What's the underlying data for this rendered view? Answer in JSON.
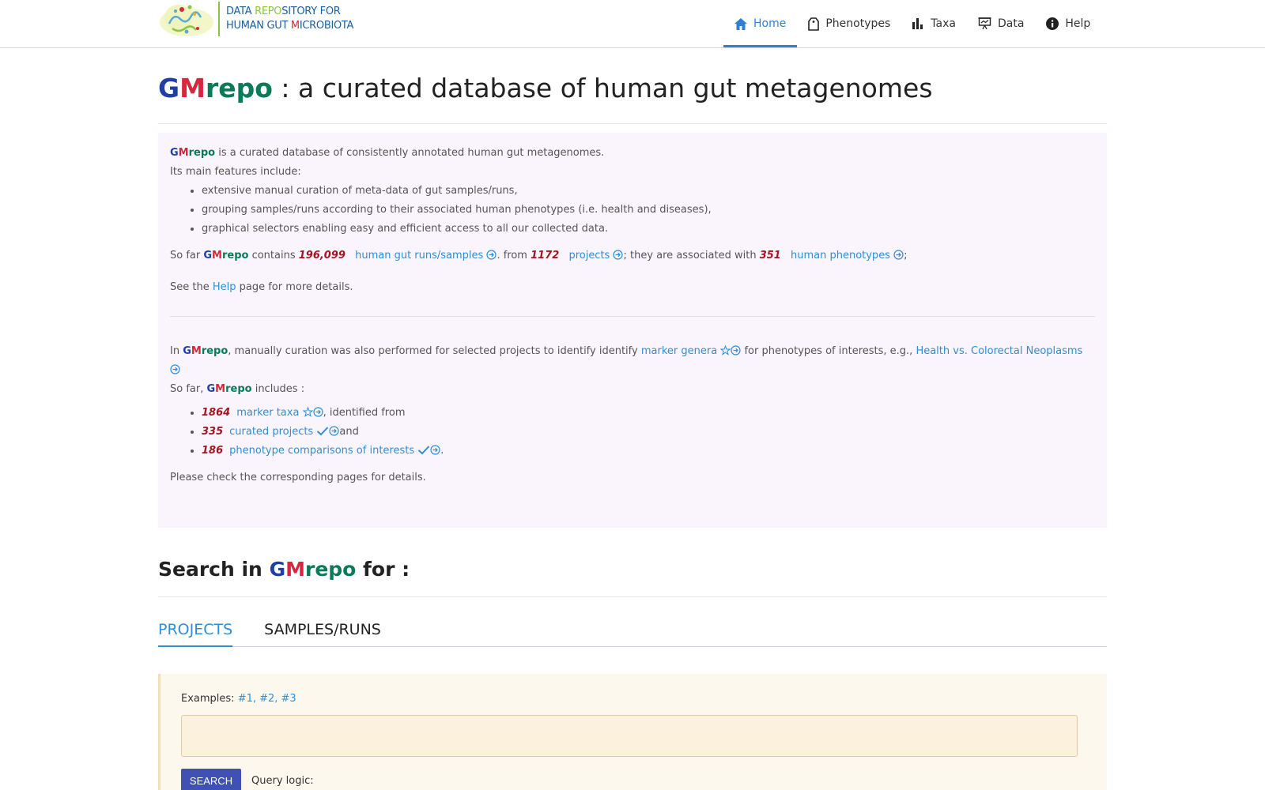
{
  "header": {
    "logo": {
      "line1": "DATA REPOSITORY FOR",
      "line2": "HUMAN GUT MICROBIOTA"
    },
    "nav": [
      {
        "label": "Home",
        "icon": "home-icon",
        "active": true
      },
      {
        "label": "Phenotypes",
        "icon": "tag-icon",
        "active": false
      },
      {
        "label": "Taxa",
        "icon": "bar-chart-icon",
        "active": false
      },
      {
        "label": "Data",
        "icon": "presentation-icon",
        "active": false
      },
      {
        "label": "Help",
        "icon": "info-icon",
        "active": false
      }
    ]
  },
  "brand": {
    "g": "G",
    "m": "M",
    "r": "repo"
  },
  "title": {
    "suffix": " : a curated database of human gut metagenomes"
  },
  "intro": {
    "desc": " is a curated database of consistently annotated human gut metagenomes.",
    "features_heading": "Its main features include:",
    "features": [
      "extensive manual curation of meta-data of gut samples/runs,",
      "grouping samples/runs according to their associated human phenotypes (i.e. health and diseases),",
      "graphical selectors enabling easy and efficient access to all our collected data."
    ],
    "so_far": "So far ",
    "contains": " contains ",
    "runs_count": "196,099",
    "runs_link": "human gut runs/samples",
    "from": ". from ",
    "projects_count": "1172",
    "projects_link": "projects",
    "associated": "; they are associated with ",
    "phenotypes_count": "351",
    "phenotypes_link": "human phenotypes",
    "semicolon": ";",
    "see_the": "See the ",
    "help_link": "Help",
    "page_details": " page for more details."
  },
  "markers": {
    "in": "In ",
    "curation": ", manually curation was also performed for selected projects to identify identify ",
    "marker_genera_link": "marker genera",
    "for_phenotypes": " for phenotypes of interests, e.g., ",
    "example_link": "Health vs. Colorectal Neoplasms",
    "so_far": "So far, ",
    "includes": " includes :",
    "items": [
      {
        "count": "1864",
        "link": "marker taxa",
        "tail": ", identified from"
      },
      {
        "count": "335",
        "link": "curated projects",
        "tail": "and"
      },
      {
        "count": "186",
        "link": "phenotype comparisons of interests",
        "tail": "."
      }
    ],
    "footer": "Please check the corresponding pages for details."
  },
  "search": {
    "prefix": "Search in ",
    "suffix": " for :",
    "tabs": [
      {
        "label": "PROJECTS",
        "active": true
      },
      {
        "label": "SAMPLES/RUNS",
        "active": false
      }
    ],
    "examples_label": "Examples: ",
    "examples": "#1, #2, #3",
    "query_value": "",
    "button": "SEARCH",
    "query_logic": "Query logic:"
  },
  "colors": {
    "brand_g": "#1f3fa6",
    "brand_m": "#d7263d",
    "brand_r": "#0a7a57",
    "link": "#2f8ed6",
    "count": "#a31621",
    "panel_bg": "#faf4fc",
    "search_bg": "#fdf8ee",
    "button": "#3f51b5"
  }
}
